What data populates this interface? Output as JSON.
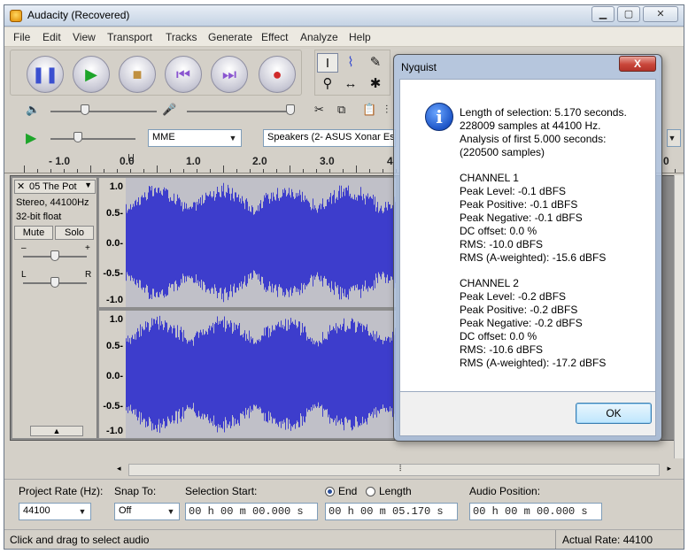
{
  "window": {
    "title": "Audacity (Recovered)"
  },
  "menu": [
    "File",
    "Edit",
    "View",
    "Transport",
    "Tracks",
    "Generate",
    "Effect",
    "Analyze",
    "Help"
  ],
  "devices": {
    "host": "MME",
    "output": "Speakers (2- ASUS Xonar Esse"
  },
  "ruler": {
    "labels": [
      "- 1.0",
      "0.0",
      "1.0",
      "2.0",
      "3.0",
      "4",
      "0"
    ]
  },
  "track": {
    "name": "05 The Pot",
    "format": "Stereo, 44100Hz",
    "bits": "32-bit float",
    "mute": "Mute",
    "solo": "Solo",
    "pan_left": "L",
    "pan_right": "R",
    "gain_minus": "–",
    "gain_plus": "+",
    "scale": [
      "1.0",
      "0.5-",
      "0.0-",
      "-0.5-",
      "-1.0"
    ]
  },
  "selection": {
    "project_rate_label": "Project Rate (Hz):",
    "project_rate": "44100",
    "snap_label": "Snap To:",
    "snap": "Off",
    "start_label": "Selection Start:",
    "start": "00 h 00 m 00.000 s",
    "end_label": "End",
    "length_label": "Length",
    "end": "00 h 00 m 05.170 s",
    "pos_label": "Audio Position:",
    "pos": "00 h 00 m 00.000 s"
  },
  "status": {
    "left": "Click and drag to select audio",
    "right": "Actual Rate: 44100"
  },
  "dialog": {
    "title": "Nyquist",
    "close": "X",
    "ok": "OK",
    "lines": [
      "Length of selection: 5.170 seconds.",
      "228009 samples at 44100 Hz.",
      "Analysis of first 5.000 seconds:",
      "(220500 samples)",
      "CHANNEL 1",
      "Peak Level: -0.1 dBFS",
      "Peak Positive: -0.1 dBFS",
      "Peak Negative: -0.1 dBFS",
      "DC offset: 0.0 %",
      "RMS: -10.0 dBFS",
      "RMS (A-weighted): -15.6 dBFS",
      "CHANNEL 2",
      "Peak Level: -0.2 dBFS",
      "Peak Positive: -0.2 dBFS",
      "Peak Negative: -0.2 dBFS",
      "DC offset: 0.0 %",
      "RMS: -10.6 dBFS",
      "RMS (A-weighted): -17.2 dBFS"
    ]
  },
  "colors": {
    "wave": "#3d3dcc",
    "wave_bg": "#c0c0c8",
    "accent": "#1e56c8"
  }
}
